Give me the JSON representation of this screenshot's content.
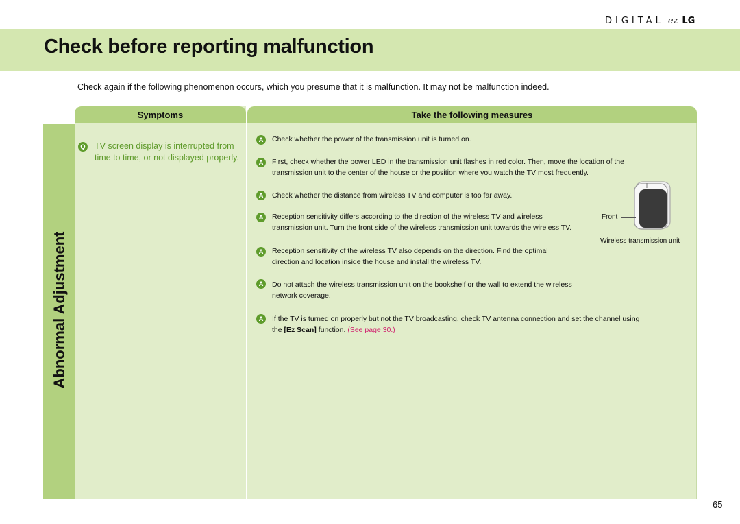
{
  "brand": {
    "digital": "DIGITAL",
    "ez": "ez",
    "lg": "LG"
  },
  "title": "Check before reporting malfunction",
  "intro": "Check again if the following phenomenon occurs, which you presume that it is malfunction. It may not be malfunction indeed.",
  "section": "Abnormal Adjustment",
  "headers": {
    "symptoms": "Symptoms",
    "measures": "Take the following measures"
  },
  "symptom": {
    "badge": "Q",
    "text": "TV screen display is interrupted from time to time, or not displayed properly."
  },
  "measures": [
    {
      "badge": "A",
      "lines": [
        "Check whether the power of the transmission unit is turned on."
      ]
    },
    {
      "badge": "A",
      "lines": [
        "First, check whether the power LED in the transmission unit flashes in red color. Then, move the location of the",
        "transmission unit to the center of the house or the position where you watch the TV most frequently."
      ]
    },
    {
      "badge": "A",
      "lines": [
        "Check whether the distance from wireless TV and computer is too far away."
      ]
    },
    {
      "badge": "A",
      "lines": [
        "Reception sensitivity differs according to the direction of the wireless TV and wireless",
        "transmission unit. Turn the front side of the wireless transmission unit towards the wireless TV."
      ]
    },
    {
      "badge": "A",
      "lines": [
        "Reception sensitivity of the wireless TV also depends on the direction. Find the optimal",
        "direction and location inside the house and install the wireless TV."
      ]
    },
    {
      "badge": "A",
      "lines": [
        "Do not attach the wireless transmission unit on the bookshelf or the wall to extend the wireless",
        "network coverage."
      ]
    },
    {
      "badge": "A",
      "line1": "If the TV is turned on properly but not the TV broadcasting, check TV antenna connection and set the channel using",
      "pre": "the ",
      "bold": "[Ez Scan]",
      "mid": " function. ",
      "link": "(See page 30.)"
    }
  ],
  "figure": {
    "front_label": "Front",
    "caption": "Wireless transmission unit",
    "icon": "wireless-transmission-unit-icon"
  },
  "page_number": "65",
  "colors": {
    "title_bar": "#d4e7b0",
    "header_green": "#b2d17f",
    "panel_bg": "#e1edca",
    "badge_green": "#5f9c2c",
    "link_pink": "#d0206e"
  }
}
